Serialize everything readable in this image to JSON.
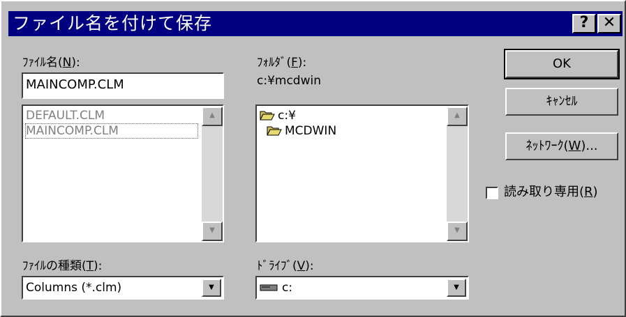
{
  "window": {
    "title": "ファイル名を付けて保存",
    "help_label": "?",
    "close_label": "✕"
  },
  "filename": {
    "label_prefix": "ﾌｧｲﾙ名(",
    "label_key": "N",
    "label_suffix": "):",
    "value": "MAINCOMP.CLM",
    "files": [
      "DEFAULT.CLM",
      "MAINCOMP.CLM"
    ]
  },
  "folder": {
    "label_prefix": "ﾌｫﾙﾀﾞ(",
    "label_key": "F",
    "label_suffix": "):",
    "current_path": "c:¥mcdwin",
    "tree": [
      "c:¥",
      "MCDWIN"
    ]
  },
  "buttons": {
    "ok": "OK",
    "cancel": "ｷｬﾝｾﾙ",
    "network_prefix": "ﾈｯﾄﾜｰｸ(",
    "network_key": "W",
    "network_suffix": ")..."
  },
  "readonly": {
    "label_prefix": "読み取り専用(",
    "label_key": "R",
    "label_suffix": ")",
    "checked": false
  },
  "filetype": {
    "label_prefix": "ﾌｧｲﾙの種類(",
    "label_key": "T",
    "label_suffix": "):",
    "selected": "Columns (*.clm)"
  },
  "drive": {
    "label_prefix": "ﾄﾞﾗｲﾌﾞ(",
    "label_key": "V",
    "label_suffix": "):",
    "selected": "c:"
  },
  "icons": {
    "folder_open": "folder-open-icon",
    "folder": "folder-icon",
    "drive": "hard-drive-icon",
    "scroll_up": "scroll-up-icon",
    "scroll_down": "scroll-down-icon",
    "dropdown": "chevron-down-icon"
  },
  "colors": {
    "titlebar": "#000080",
    "face": "#c0c0c0",
    "folder": "#d0c060"
  }
}
